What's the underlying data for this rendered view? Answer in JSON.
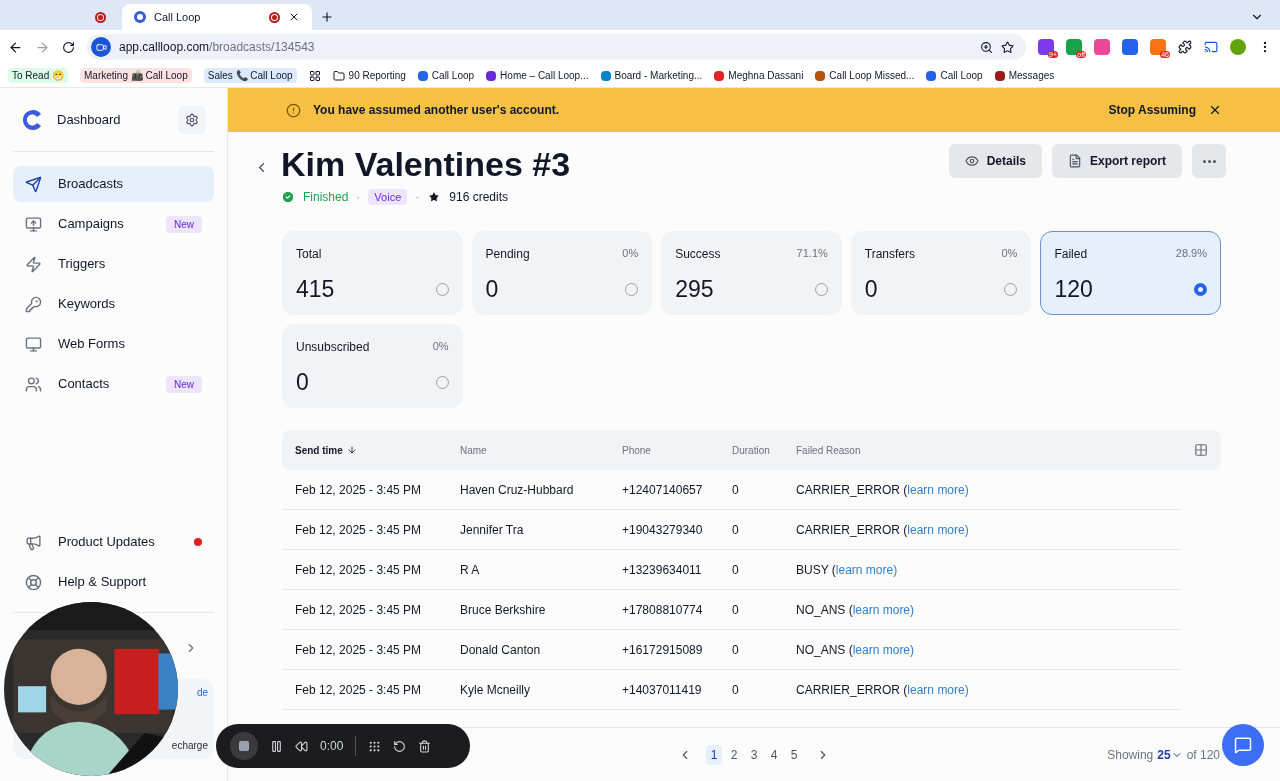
{
  "browser": {
    "tabs": [
      {
        "selected": false
      },
      {
        "title": "Call Loop",
        "selected": true
      }
    ],
    "url_host": "app.callloop.com",
    "url_path": "/broadcasts/134543",
    "extensions": [
      {
        "badge": "9+",
        "color": "#7c3aed"
      },
      {
        "badge": "off",
        "color": "#16a34a"
      },
      {
        "color": "#ec4899"
      },
      {
        "color": "#2563eb"
      },
      {
        "badge": "46",
        "color": "#f97316"
      }
    ],
    "bookmarks": [
      {
        "kind": "chip",
        "label": "To Read 😁",
        "color": "#dcfce7"
      },
      {
        "kind": "chip",
        "label": "Marketing 📠 Call Loop",
        "color": "#fee2e2"
      },
      {
        "kind": "chip",
        "label": "Sales 📞 Call Loop",
        "color": "#dbeafe"
      },
      {
        "kind": "apps"
      },
      {
        "kind": "folder",
        "label": "90 Reporting"
      },
      {
        "kind": "link",
        "label": "Call Loop",
        "color": "#2563eb"
      },
      {
        "kind": "link",
        "label": "Home – Call Loop...",
        "color": "#6d28d9"
      },
      {
        "kind": "link",
        "label": "Board - Marketing...",
        "color": "#0284c7"
      },
      {
        "kind": "link",
        "label": "Meghna Dassani",
        "color": "#dc2626"
      },
      {
        "kind": "link",
        "label": "Call Loop Missed...",
        "color": "#b45309"
      },
      {
        "kind": "link",
        "label": "Call Loop",
        "color": "#2563eb"
      },
      {
        "kind": "link",
        "label": "Messages",
        "color": "#991b1b"
      }
    ]
  },
  "sidebar": {
    "title": "Dashboard",
    "items": [
      {
        "label": "Broadcasts",
        "selected": true
      },
      {
        "label": "Campaigns",
        "selected": false,
        "badge": "New"
      },
      {
        "label": "Triggers",
        "selected": false
      },
      {
        "label": "Keywords",
        "selected": false
      },
      {
        "label": "Web Forms",
        "selected": false
      },
      {
        "label": "Contacts",
        "selected": false,
        "badge": "New"
      }
    ],
    "bottom_items": [
      {
        "label": "Product Updates",
        "unread": true
      },
      {
        "label": "Help & Support",
        "unread": false
      }
    ],
    "card_link": "de",
    "card_button": "echarge"
  },
  "banner": {
    "message": "You have assumed another user's account.",
    "action": "Stop Assuming"
  },
  "header": {
    "title": "Kim Valentines #3",
    "status": "Finished",
    "separator_1": "·",
    "type": "Voice",
    "separator_2": "·",
    "credits": "916 credits",
    "buttons": [
      "Details",
      "Export report"
    ]
  },
  "stats": [
    {
      "label": "Total",
      "value": "415",
      "selected": false
    },
    {
      "label": "Pending",
      "percent": "0%",
      "value": "0",
      "selected": false
    },
    {
      "label": "Success",
      "percent": "71.1%",
      "value": "295",
      "selected": false
    },
    {
      "label": "Transfers",
      "percent": "0%",
      "value": "0",
      "selected": false
    },
    {
      "label": "Failed",
      "percent": "28.9%",
      "value": "120",
      "selected": true
    },
    {
      "label": "Unsubscribed",
      "percent": "0%",
      "value": "0",
      "selected": false
    }
  ],
  "table": {
    "columns": [
      "Send time",
      "Name",
      "Phone",
      "Duration",
      "Failed Reason"
    ],
    "rows": [
      {
        "send_time": "Feb 12, 2025 - 3:45 PM",
        "name": "Haven Cruz-Hubbard",
        "phone": "+12407140657",
        "duration": "0",
        "reason": "CARRIER_ERROR (",
        "link": "learn more)"
      },
      {
        "send_time": "Feb 12, 2025 - 3:45 PM",
        "name": "Jennifer Tra",
        "phone": "+19043279340",
        "duration": "0",
        "reason": "CARRIER_ERROR (",
        "link": "learn more)"
      },
      {
        "send_time": "Feb 12, 2025 - 3:45 PM",
        "name": "R A",
        "phone": "+13239634011",
        "duration": "0",
        "reason": "BUSY (",
        "link": "learn more)"
      },
      {
        "send_time": "Feb 12, 2025 - 3:45 PM",
        "name": "Bruce Berkshire",
        "phone": "+17808810774",
        "duration": "0",
        "reason": "NO_ANS (",
        "link": "learn more)"
      },
      {
        "send_time": "Feb 12, 2025 - 3:45 PM",
        "name": "Donald Canton",
        "phone": "+16172915089",
        "duration": "0",
        "reason": "NO_ANS (",
        "link": "learn more)"
      },
      {
        "send_time": "Feb 12, 2025 - 3:45 PM",
        "name": "Kyle Mcneilly",
        "phone": "+14037011419",
        "duration": "0",
        "reason": "CARRIER_ERROR (",
        "link": "learn more)"
      }
    ]
  },
  "pagination": {
    "pages": [
      {
        "label": "1",
        "selected": true
      },
      {
        "label": "2",
        "selected": false
      },
      {
        "label": "3",
        "selected": false
      },
      {
        "label": "4",
        "selected": false
      },
      {
        "label": "5",
        "selected": false
      }
    ],
    "showing_label": "Showing",
    "page_size": "25",
    "total": "of 120"
  },
  "recorder": {
    "time": "0:00"
  }
}
